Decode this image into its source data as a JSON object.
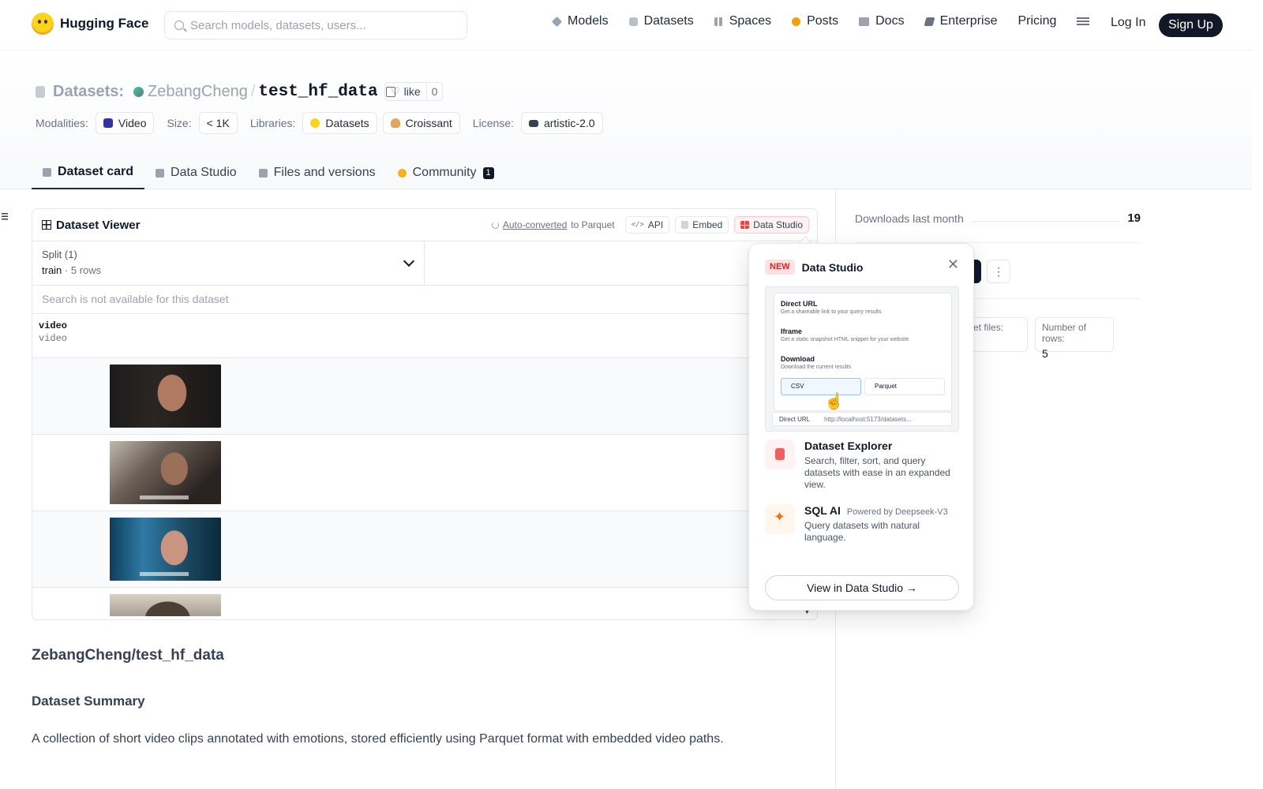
{
  "header": {
    "brand": "Hugging Face",
    "search_placeholder": "Search models, datasets, users...",
    "nav": [
      {
        "label": "Models",
        "icon": "models-icon"
      },
      {
        "label": "Datasets",
        "icon": "datasets-icon"
      },
      {
        "label": "Spaces",
        "icon": "spaces-icon"
      },
      {
        "label": "Posts",
        "icon": "posts-icon"
      },
      {
        "label": "Docs",
        "icon": "docs-icon"
      },
      {
        "label": "Enterprise",
        "icon": "enterprise-icon"
      },
      {
        "label": "Pricing",
        "icon": ""
      }
    ],
    "login": "Log In",
    "signup": "Sign Up"
  },
  "repo": {
    "type_label": "Datasets:",
    "owner": "ZebangCheng",
    "separator": "/",
    "name": "test_hf_data",
    "like_label": "like",
    "like_count": "0",
    "meta": {
      "modalities_label": "Modalities:",
      "modality": "Video",
      "size_label": "Size:",
      "size": "< 1K",
      "libraries_label": "Libraries:",
      "lib1": "Datasets",
      "lib2": "Croissant",
      "license_label": "License:",
      "license": "artistic-2.0"
    },
    "tabs": {
      "card": "Dataset card",
      "studio": "Data Studio",
      "files": "Files and versions",
      "community": "Community",
      "community_count": "1"
    }
  },
  "viewer": {
    "title": "Dataset Viewer",
    "auto_converted": "Auto-converted",
    "to_parquet": "to Parquet",
    "api": "API",
    "embed": "Embed",
    "studio": "Data Studio",
    "split_label": "Split (1)",
    "split_value": "train",
    "split_dot": "·",
    "split_rows": "5 rows",
    "search_placeholder": "Search is not available for this dataset",
    "column_name": "video",
    "column_type": "video"
  },
  "sidebar": {
    "downloads_label": "Downloads last month",
    "downloads_value": "19",
    "parquet_label": "arquet files:",
    "rows_label": "Number of rows:",
    "rows_value": "5"
  },
  "card": {
    "title": "ZebangCheng/test_hf_data",
    "summary_heading": "Dataset Summary",
    "summary_text": "A collection of short video clips annotated with emotions, stored efficiently using Parquet format with embedded video paths."
  },
  "popover": {
    "badge": "NEW",
    "title": "Data Studio",
    "close": "✕",
    "preview": {
      "h1": "Direct URL",
      "s1": "Get a shareable link to your query results",
      "h2": "Iframe",
      "s2": "Get a static snapshot HTML snippet for your website",
      "h3": "Download",
      "s3": "Download the current results",
      "csv": "CSV",
      "parquet": "Parquet",
      "bar_label": "Direct URL",
      "bar_url": "http://localhost:5173/datasets..."
    },
    "explorer_title": "Dataset Explorer",
    "explorer_desc": "Search, filter, sort, and query datasets with ease in an expanded view.",
    "sql_title": "SQL AI",
    "sql_powered": "Powered by Deepseek-V3",
    "sql_desc": "Query datasets with natural language.",
    "cta": "View in Data Studio →"
  },
  "colors": {
    "accent_red": "#ef4444",
    "brand_yellow": "#ffd21e",
    "dark": "#111827"
  }
}
